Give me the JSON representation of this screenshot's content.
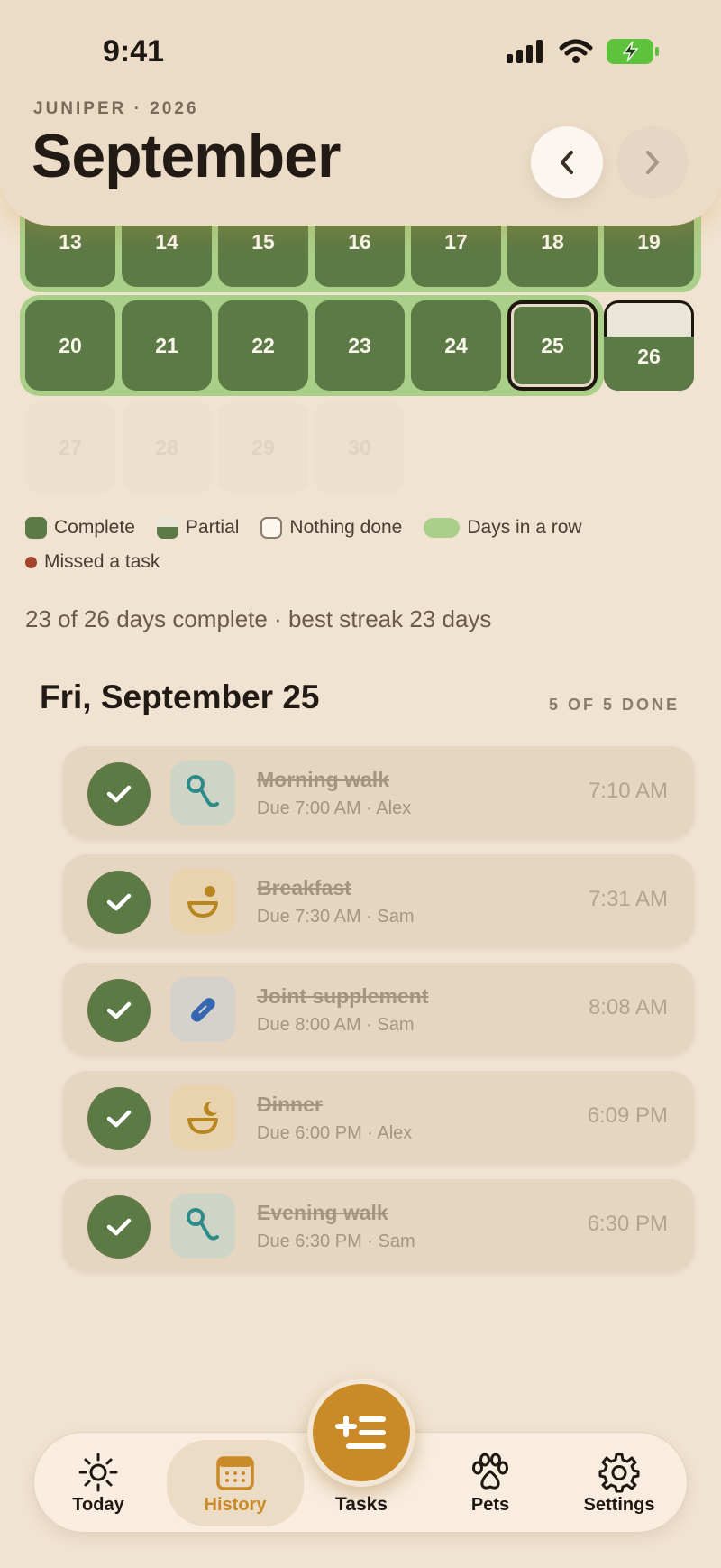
{
  "status_bar": {
    "time": "9:41"
  },
  "header": {
    "eyebrow": "JUNIPER · 2026",
    "month": "September"
  },
  "calendar": {
    "week3": [
      "13",
      "14",
      "15",
      "16",
      "17",
      "18",
      "19"
    ],
    "week4": [
      "20",
      "21",
      "22",
      "23",
      "24",
      "25",
      "26"
    ],
    "week5": [
      "27",
      "28",
      "29",
      "30"
    ],
    "selected_day": "25",
    "partial_day": "26"
  },
  "legend": {
    "complete": "Complete",
    "partial": "Partial",
    "nothing": "Nothing done",
    "streak": "Days in a row",
    "missed": "Missed a task"
  },
  "summary": "23 of 26 days complete · best streak 23 days",
  "detail": {
    "title": "Fri, September 25",
    "count": "5 OF 5 DONE",
    "tasks": [
      {
        "name": "Morning walk",
        "due": "Due 7:00 AM · Alex",
        "done_at": "7:10 AM",
        "icon": "leash-icon"
      },
      {
        "name": "Breakfast",
        "due": "Due 7:30 AM · Sam",
        "done_at": "7:31 AM",
        "icon": "food-bowl-icon"
      },
      {
        "name": "Joint supplement",
        "due": "Due 8:00 AM · Sam",
        "done_at": "8:08 AM",
        "icon": "pill-icon"
      },
      {
        "name": "Dinner",
        "due": "Due 6:00 PM · Alex",
        "done_at": "6:09 PM",
        "icon": "dinner-bowl-icon"
      },
      {
        "name": "Evening walk",
        "due": "Due 6:30 PM · Sam",
        "done_at": "6:30 PM",
        "icon": "leash-icon"
      }
    ]
  },
  "nav": {
    "today": "Today",
    "history": "History",
    "tasks": "Tasks",
    "pets": "Pets",
    "settings": "Settings"
  },
  "colors": {
    "accent": "#c98a27",
    "complete_green": "#5c7a45",
    "streak_green": "#a9cf89",
    "missed_red": "#a4442a",
    "background": "#f1e3d2"
  }
}
